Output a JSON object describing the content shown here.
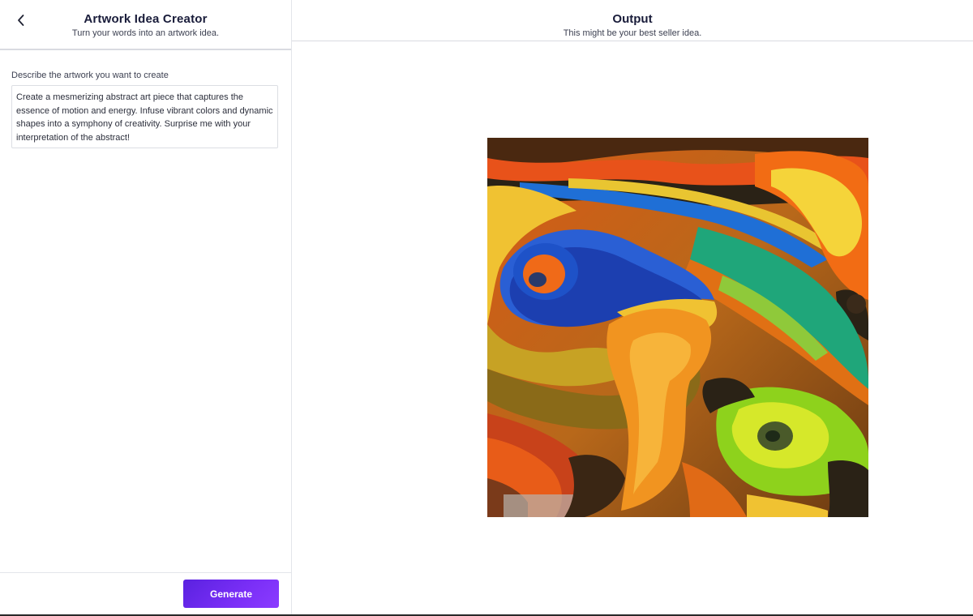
{
  "left_panel": {
    "title": "Artwork Idea Creator",
    "subtitle": "Turn your words into an artwork idea.",
    "prompt_label": "Describe the artwork you want to create",
    "prompt_value": "Create a mesmerizing abstract art piece that captures the essence of motion and energy. Infuse vibrant colors and dynamic shapes into a symphony of creativity. Surprise me with your interpretation of the abstract!",
    "generate_label": "Generate",
    "back_icon": "chevron-left-icon"
  },
  "output_panel": {
    "title": "Output",
    "subtitle": "This might be your best seller idea.",
    "image_icon": "abstract-artwork-image"
  },
  "colors": {
    "accent": "#6a28f0",
    "title": "#191c3a",
    "border": "#d9dbe1"
  }
}
